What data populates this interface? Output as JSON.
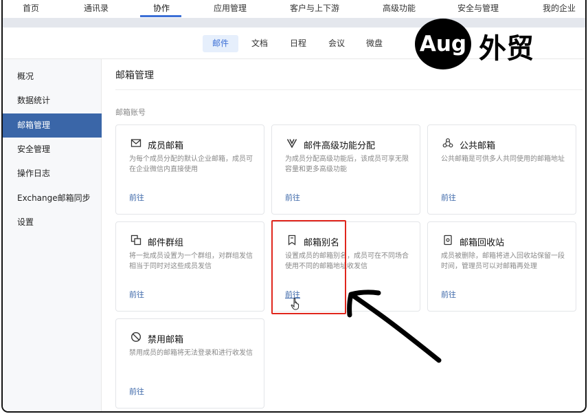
{
  "topnav": {
    "items": [
      "首页",
      "通讯录",
      "协作",
      "应用管理",
      "客户与上下游",
      "高级功能",
      "安全与管理",
      "我的企业"
    ],
    "active_index": 2
  },
  "subnav": {
    "tabs": [
      "邮件",
      "文档",
      "日程",
      "会议",
      "微盘"
    ],
    "active_index": 0
  },
  "brand": {
    "circle_text": "Aug",
    "text": "外贸"
  },
  "sidebar": {
    "items": [
      "概况",
      "数据统计",
      "邮箱管理",
      "安全管理",
      "操作日志",
      "Exchange邮箱同步",
      "设置"
    ],
    "active_index": 2
  },
  "main": {
    "title": "邮箱管理",
    "section_label": "邮箱账号",
    "cards": [
      {
        "icon": "envelope-icon",
        "title": "成员邮箱",
        "desc": "为每个成员分配的默认企业邮箱，成员可在企业微信内直接使用",
        "link": "前往"
      },
      {
        "icon": "v-icon",
        "title": "邮件高级功能分配",
        "desc": "为成员分配高级功能后，该成员可享无限容量和更多高级功能",
        "link": "前往"
      },
      {
        "icon": "shared-mailbox-icon",
        "title": "公共邮箱",
        "desc": "公共邮箱是可供多人共同使用的邮箱地址",
        "link": "前往"
      },
      {
        "icon": "group-icon",
        "title": "邮件群组",
        "desc": "将一批成员设置为一个群组，对群组发信相当于同时对这些成员发信",
        "link": "前往"
      },
      {
        "icon": "bookmark-icon",
        "title": "邮箱别名",
        "desc": "设置成员的邮箱别名，成员可在不同场合使用不同的邮箱地址收发信",
        "link": "前往"
      },
      {
        "icon": "recycle-bin-icon",
        "title": "邮箱回收站",
        "desc": "成员被删除，邮箱将进入回收站保留一段时间，管理员可以对邮箱再处理",
        "link": "前往"
      },
      {
        "icon": "ban-icon",
        "title": "禁用邮箱",
        "desc": "禁用成员的邮箱将无法登录和进行收发信",
        "link": "前往"
      }
    ]
  },
  "colors": {
    "accent": "#3a66a8",
    "highlight": "#e0261c",
    "tab_active_bg": "#e6effc"
  }
}
